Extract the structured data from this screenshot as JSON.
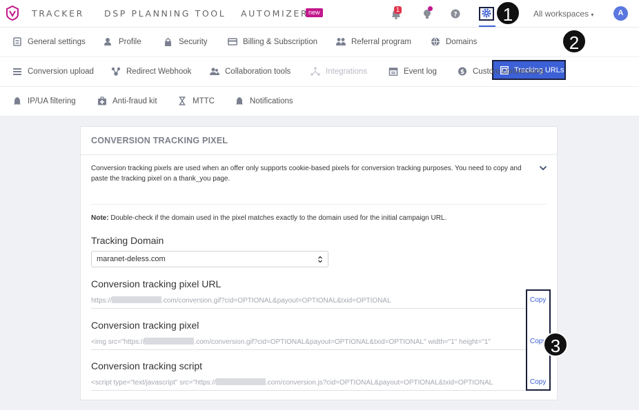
{
  "topbar": {
    "nav": [
      "TRACKER",
      "DSP PLANNING TOOL",
      "AUTOMIZER"
    ],
    "new_badge": "new",
    "notifications_count": "1",
    "workspace": "All workspaces",
    "avatar_initial": "A",
    "icons": [
      "bell-icon",
      "bulb-icon",
      "help-icon",
      "gear-icon"
    ]
  },
  "steps": [
    "1",
    "2",
    "3"
  ],
  "tabs": {
    "row1": [
      "General settings",
      "Profile",
      "Security",
      "Billing & Subscription",
      "Referral program",
      "Domains"
    ],
    "active": "Tracking URLs",
    "row2": [
      "Conversion upload",
      "Redirect Webhook",
      "Collaboration tools",
      "Integrations",
      "Event log",
      "Custom conversions"
    ],
    "row3": [
      "IP/UA filtering",
      "Anti-fraud kit",
      "MTTC",
      "Notifications"
    ]
  },
  "card": {
    "title": "CONVERSION TRACKING PIXEL",
    "description": "Conversion tracking pixels are used when an offer only supports cookie-based pixels for conversion tracking purposes. You need to copy and paste the tracking pixel on a thank_you page.",
    "note_label": "Note:",
    "note_text": " Double-check if the domain used in the pixel matches exactly to the domain used for the initial campaign URL.",
    "domain_label": "Tracking Domain",
    "domain_value": "maranet-deless.com",
    "pixel_url_label": "Conversion tracking pixel URL",
    "pixel_url_pre": "https://",
    "pixel_url_post": ".com/conversion.gif?cid=OPTIONAL&payout=OPTIONAL&txid=OPTIONAL",
    "pixel_label": "Conversion tracking pixel",
    "pixel_pre": "<img src=\"https://",
    "pixel_post": ".com/conversion.gif?cid=OPTIONAL&payout=OPTIONAL&txid=OPTIONAL\" width=\"1\" height=\"1\"",
    "script_label": "Conversion tracking script",
    "script_pre": "<script type=\"text/javascript\" src=\"https://",
    "script_post": ".com/conversion.js?cid=OPTIONAL&payout=OPTIONAL&txid=OPTIONAL",
    "copy_label": "Copy"
  },
  "colors": {
    "accent": "#3c60d6",
    "brand": "#c2188c",
    "annotation": "#1a1f3d"
  }
}
